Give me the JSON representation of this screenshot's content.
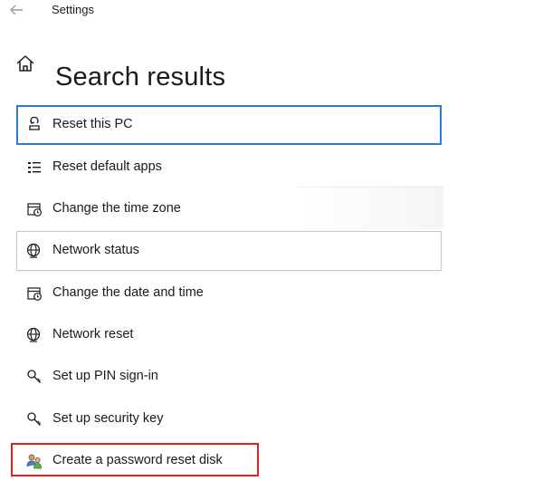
{
  "window": {
    "title": "Settings"
  },
  "page": {
    "title": "Search results"
  },
  "results": [
    {
      "label": "Reset this PC",
      "icon": "reset-pc-icon",
      "state": "focused"
    },
    {
      "label": "Reset default apps",
      "icon": "default-apps-icon"
    },
    {
      "label": "Change the time zone",
      "icon": "calendar-clock-icon"
    },
    {
      "label": "Network status",
      "icon": "globe-icon",
      "state": "hover"
    },
    {
      "label": "Change the date and time",
      "icon": "calendar-clock-icon"
    },
    {
      "label": "Network reset",
      "icon": "globe-icon"
    },
    {
      "label": "Set up PIN sign-in",
      "icon": "key-icon"
    },
    {
      "label": "Set up security key",
      "icon": "key-icon"
    },
    {
      "label": "Create a password reset disk",
      "icon": "users-icon",
      "state": "highlighted"
    }
  ],
  "colors": {
    "focus": "#2e7bd0",
    "highlight": "#e02020",
    "text": "#1a1a1a"
  }
}
